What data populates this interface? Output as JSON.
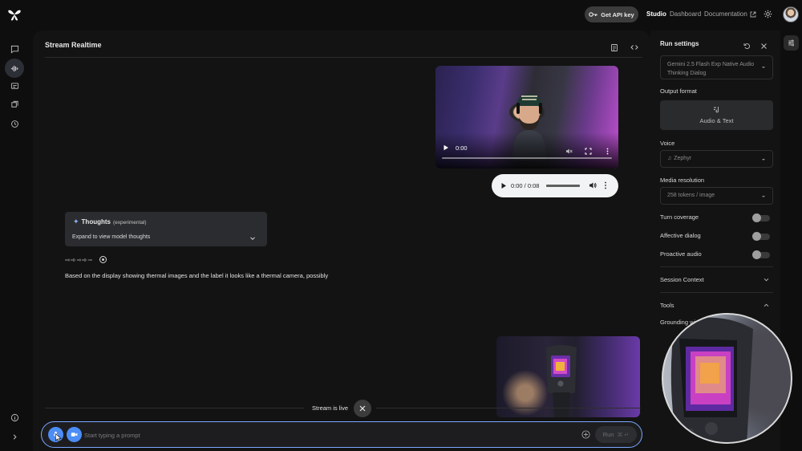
{
  "topbar": {
    "api_key_label": "Get API key",
    "nav": {
      "studio": "Studio",
      "dashboard": "Dashboard",
      "documentation": "Documentation"
    }
  },
  "main": {
    "title": "Stream Realtime",
    "video": {
      "time": "0:00"
    },
    "audio": {
      "time": "0:00 / 0:08"
    },
    "thoughts": {
      "title": "Thoughts",
      "badge": "(experimental)",
      "expand": "Expand to view model thoughts"
    },
    "response": "Based on the display showing thermal images and the label it looks like a thermal camera, possibly",
    "stream_status": "Stream is live",
    "prompt": {
      "placeholder": "Start typing a prompt",
      "run_label": "Run",
      "run_shortcut": "⌘ ↵"
    }
  },
  "settings": {
    "title": "Run settings",
    "model": "Gemini 2.5 Flash Exp Native Audio Thinking Dialog",
    "output_format_label": "Output format",
    "output_format_value": "Audio & Text",
    "voice_label": "Voice",
    "voice_value": "Zephyr",
    "media_resolution_label": "Media resolution",
    "media_resolution_value": "258 tokens / image",
    "turn_coverage": {
      "label": "Turn coverage",
      "on": false
    },
    "affective_dialog": {
      "label": "Affective dialog",
      "on": false
    },
    "proactive_audio": {
      "label": "Proactive audio",
      "on": false
    },
    "session_context_label": "Session Context",
    "tools_label": "Tools",
    "grounding_label": "Grounding wi"
  },
  "colors": {
    "accent": "#4c8df6",
    "prompt_border": "#7aa7ff",
    "thoughts_star": "#8ab4f8"
  }
}
